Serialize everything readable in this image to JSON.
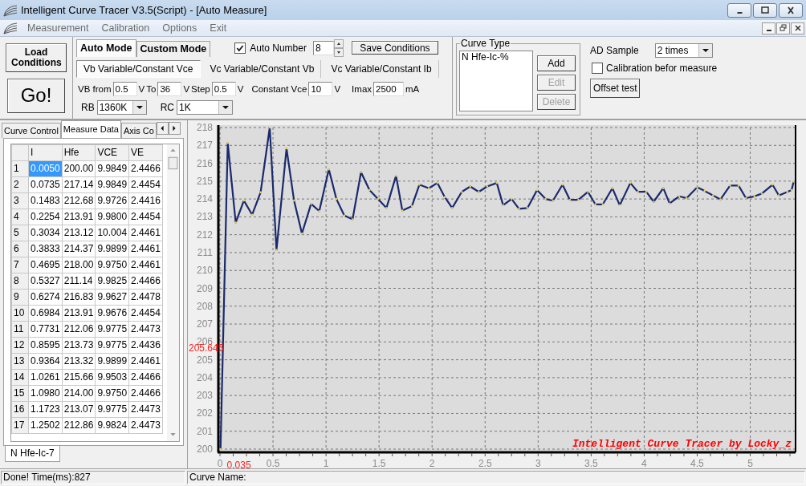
{
  "window": {
    "title": "Intelligent Curve Tracer V3.5(Script) - [Auto Measure]"
  },
  "menu": [
    "Measurement",
    "Calibration",
    "Options",
    "Exit"
  ],
  "toolbar": {
    "load_button": "Load\nConditions",
    "go_button": "Go!",
    "mode_tabs": [
      {
        "label": "Auto Mode",
        "selected": true
      },
      {
        "label": "Custom Mode",
        "selected": false
      }
    ],
    "auto_number": {
      "label": "Auto Number",
      "checked": true,
      "value": "8"
    },
    "save_button": "Save Conditions",
    "sweep_modes": [
      {
        "label": "Vb Variable/Constant Vce",
        "selected": true
      },
      {
        "label": "Vc Variable/Constant Vb",
        "selected": false
      },
      {
        "label": "Vc Variable/Constant Ib",
        "selected": false
      }
    ],
    "params": [
      {
        "label": "VB from",
        "value": "0.5",
        "unit": "V"
      },
      {
        "label": "To",
        "value": "36",
        "unit": "V"
      },
      {
        "label": "Step",
        "value": "0.5",
        "unit": "V"
      },
      {
        "label": "Constant Vce",
        "value": "10",
        "unit": "V"
      },
      {
        "label": "Imax",
        "value": "2500",
        "unit": "mA"
      }
    ],
    "selects": [
      {
        "label": "RB",
        "value": "1360K"
      },
      {
        "label": "RC",
        "value": "1K"
      }
    ],
    "curve_type": {
      "title": "Curve Type",
      "items": [
        "N Hfe-Ic-%"
      ],
      "buttons": [
        {
          "label": "Add",
          "disabled": false
        },
        {
          "label": "Edit",
          "disabled": true
        },
        {
          "label": "Delete",
          "disabled": true
        }
      ]
    },
    "ad_sample": {
      "label": "AD Sample",
      "value": "2 times"
    },
    "calibration": {
      "label": "Calibration befor measure",
      "checked": false
    },
    "offset_button": "Offset test"
  },
  "left_panel": {
    "tabs": [
      {
        "label": "Curve Control",
        "selected": false
      },
      {
        "label": "Measure Data",
        "selected": true
      },
      {
        "label": "Axis Co",
        "selected": false
      }
    ],
    "columns": [
      "I",
      "Hfe",
      "VCE",
      "VE"
    ],
    "rows": [
      {
        "n": "1",
        "cells": [
          {
            "text": "0.0050",
            "selected": true
          },
          {
            "text": "200.00",
            "selected": false
          },
          {
            "text": "9.9849",
            "selected": false
          },
          {
            "text": "2.4466",
            "selected": false
          }
        ]
      },
      {
        "n": "2",
        "cells": [
          {
            "text": "0.0735",
            "selected": false
          },
          {
            "text": "217.14",
            "selected": false
          },
          {
            "text": "9.9849",
            "selected": false
          },
          {
            "text": "2.4454",
            "selected": false
          }
        ]
      },
      {
        "n": "3",
        "cells": [
          {
            "text": "0.1483",
            "selected": false
          },
          {
            "text": "212.68",
            "selected": false
          },
          {
            "text": "9.9726",
            "selected": false
          },
          {
            "text": "2.4416",
            "selected": false
          }
        ]
      },
      {
        "n": "4",
        "cells": [
          {
            "text": "0.2254",
            "selected": false
          },
          {
            "text": "213.91",
            "selected": false
          },
          {
            "text": "9.9800",
            "selected": false
          },
          {
            "text": "2.4454",
            "selected": false
          }
        ]
      },
      {
        "n": "5",
        "cells": [
          {
            "text": "0.3034",
            "selected": false
          },
          {
            "text": "213.12",
            "selected": false
          },
          {
            "text": "10.004",
            "selected": false
          },
          {
            "text": "2.4461",
            "selected": false
          }
        ]
      },
      {
        "n": "6",
        "cells": [
          {
            "text": "0.3833",
            "selected": false
          },
          {
            "text": "214.37",
            "selected": false
          },
          {
            "text": "9.9899",
            "selected": false
          },
          {
            "text": "2.4461",
            "selected": false
          }
        ]
      },
      {
        "n": "7",
        "cells": [
          {
            "text": "0.4695",
            "selected": false
          },
          {
            "text": "218.00",
            "selected": false
          },
          {
            "text": "9.9750",
            "selected": false
          },
          {
            "text": "2.4461",
            "selected": false
          }
        ]
      },
      {
        "n": "8",
        "cells": [
          {
            "text": "0.5327",
            "selected": false
          },
          {
            "text": "211.14",
            "selected": false
          },
          {
            "text": "9.9825",
            "selected": false
          },
          {
            "text": "2.4466",
            "selected": false
          }
        ]
      },
      {
        "n": "9",
        "cells": [
          {
            "text": "0.6274",
            "selected": false
          },
          {
            "text": "216.83",
            "selected": false
          },
          {
            "text": "9.9627",
            "selected": false
          },
          {
            "text": "2.4478",
            "selected": false
          }
        ]
      },
      {
        "n": "10",
        "cells": [
          {
            "text": "0.6984",
            "selected": false
          },
          {
            "text": "213.91",
            "selected": false
          },
          {
            "text": "9.9676",
            "selected": false
          },
          {
            "text": "2.4454",
            "selected": false
          }
        ]
      },
      {
        "n": "11",
        "cells": [
          {
            "text": "0.7731",
            "selected": false
          },
          {
            "text": "212.06",
            "selected": false
          },
          {
            "text": "9.9775",
            "selected": false
          },
          {
            "text": "2.4473",
            "selected": false
          }
        ]
      },
      {
        "n": "12",
        "cells": [
          {
            "text": "0.8595",
            "selected": false
          },
          {
            "text": "213.73",
            "selected": false
          },
          {
            "text": "9.9775",
            "selected": false
          },
          {
            "text": "2.4436",
            "selected": false
          }
        ]
      },
      {
        "n": "13",
        "cells": [
          {
            "text": "0.9364",
            "selected": false
          },
          {
            "text": "213.32",
            "selected": false
          },
          {
            "text": "9.9899",
            "selected": false
          },
          {
            "text": "2.4461",
            "selected": false
          }
        ]
      },
      {
        "n": "14",
        "cells": [
          {
            "text": "1.0261",
            "selected": false
          },
          {
            "text": "215.66",
            "selected": false
          },
          {
            "text": "9.9503",
            "selected": false
          },
          {
            "text": "2.4466",
            "selected": false
          }
        ]
      },
      {
        "n": "15",
        "cells": [
          {
            "text": "1.0980",
            "selected": false
          },
          {
            "text": "214.00",
            "selected": false
          },
          {
            "text": "9.9750",
            "selected": false
          },
          {
            "text": "2.4466",
            "selected": false
          }
        ]
      },
      {
        "n": "16",
        "cells": [
          {
            "text": "1.1723",
            "selected": false
          },
          {
            "text": "213.07",
            "selected": false
          },
          {
            "text": "9.9775",
            "selected": false
          },
          {
            "text": "2.4473",
            "selected": false
          }
        ]
      },
      {
        "n": "17",
        "cells": [
          {
            "text": "1.2502",
            "selected": false
          },
          {
            "text": "212.86",
            "selected": false
          },
          {
            "text": "9.9824",
            "selected": false
          },
          {
            "text": "2.4473",
            "selected": false
          }
        ]
      }
    ],
    "bottom_tab": "N Hfe-Ic-7"
  },
  "chart": {
    "signature": "Intelligent Curve Tracer by Locky_z",
    "chart_data": {
      "type": "line",
      "grid": true,
      "xlim": [
        0,
        5.42
      ],
      "ylim": [
        200,
        218
      ],
      "xticks": [
        0,
        0.5,
        1,
        1.5,
        2,
        2.5,
        3,
        3.5,
        4,
        4.5,
        5
      ],
      "yticks": [
        200,
        201,
        202,
        203,
        204,
        205,
        206,
        207,
        208,
        209,
        210,
        211,
        212,
        213,
        214,
        215,
        216,
        217,
        218
      ],
      "x": [
        0.005,
        0.0735,
        0.1483,
        0.2254,
        0.3034,
        0.3833,
        0.4695,
        0.5327,
        0.6274,
        0.6984,
        0.7731,
        0.8595,
        0.9364,
        1.0261,
        1.098,
        1.1723,
        1.2502,
        1.33,
        1.41,
        1.49,
        1.57,
        1.66,
        1.72,
        1.81,
        1.88,
        1.97,
        2.05,
        2.12,
        2.19,
        2.28,
        2.36,
        2.44,
        2.52,
        2.61,
        2.67,
        2.75,
        2.82,
        2.9,
        2.99,
        3.07,
        3.14,
        3.23,
        3.3,
        3.38,
        3.47,
        3.54,
        3.61,
        3.7,
        3.77,
        3.87,
        3.94,
        4.02,
        4.09,
        4.18,
        4.24,
        4.33,
        4.4,
        4.5,
        4.57,
        4.65,
        4.72,
        4.81,
        4.89,
        4.96,
        5.04,
        5.11,
        5.21,
        5.27,
        5.35,
        5.39,
        5.41
      ],
      "series": [
        {
          "color": "#1a2a6c",
          "values": [
            200,
            217.14,
            212.68,
            213.91,
            213.12,
            214.37,
            218,
            211.14,
            216.83,
            213.91,
            212.06,
            213.73,
            213.32,
            215.66,
            214,
            213.07,
            212.86,
            215.5,
            214.5,
            214,
            213.5,
            215.3,
            213.35,
            213.6,
            214.8,
            214.6,
            214.9,
            214.1,
            213.5,
            214.4,
            214.7,
            214.4,
            214.7,
            214.9,
            213.65,
            214,
            213.45,
            213.5,
            214.5,
            214,
            213.9,
            214.8,
            213.95,
            213.95,
            214.4,
            213.7,
            213.7,
            214.6,
            213.65,
            214.9,
            214.4,
            214.4,
            213.85,
            214.6,
            213.75,
            214.15,
            214.05,
            214.65,
            214.45,
            214.2,
            213.98,
            214.75,
            214.75,
            214.05,
            214.15,
            214.3,
            214.8,
            214.2,
            214.4,
            214.5,
            214.97
          ]
        }
      ],
      "annotations": [
        "205.645",
        "0.035"
      ]
    }
  },
  "status_bar": {
    "left": "Done!  Time(ms):827",
    "right": "Curve Name:"
  }
}
